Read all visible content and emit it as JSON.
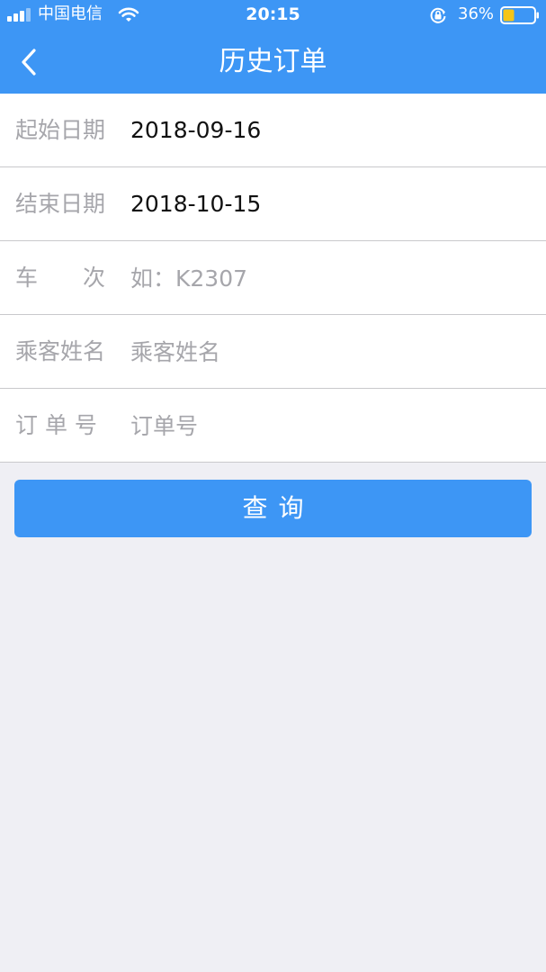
{
  "status_bar": {
    "carrier": "中国电信",
    "time": "20:15",
    "battery_percent": "36%",
    "battery_level": 0.36,
    "icons": [
      "signal-icon",
      "wifi-icon",
      "orientation-lock-icon",
      "battery-icon"
    ]
  },
  "nav": {
    "title": "历史订单",
    "back_icon": "chevron-left-icon"
  },
  "form": {
    "start_date": {
      "label": "起始日期",
      "value": "2018-09-16"
    },
    "end_date": {
      "label": "结束日期",
      "value": "2018-10-15"
    },
    "train_number": {
      "label": "车　　次",
      "placeholder": "如：K2307"
    },
    "passenger_name": {
      "label": "乘客姓名",
      "placeholder": "乘客姓名"
    },
    "order_number": {
      "label": "订 单 号",
      "placeholder": "订单号"
    }
  },
  "actions": {
    "query_label": "查询"
  },
  "colors": {
    "primary": "#3d96f5",
    "background": "#efeff4",
    "label_gray": "#a6a6ab",
    "battery_fill": "#f5c518"
  }
}
